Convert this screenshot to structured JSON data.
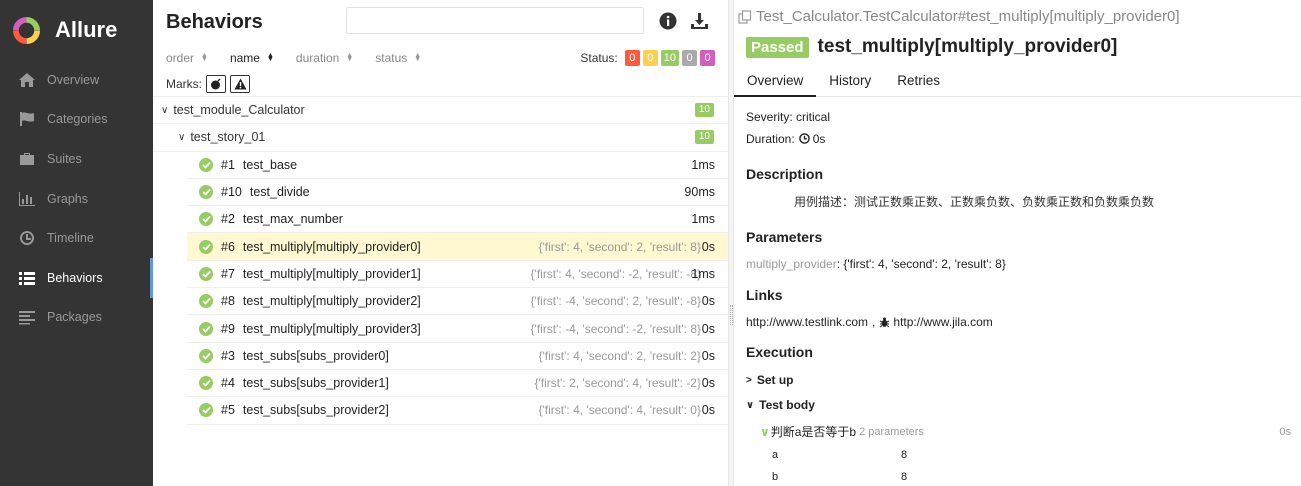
{
  "app": {
    "name": "Allure"
  },
  "sidebar": {
    "items": [
      {
        "label": "Overview",
        "icon": "home-icon",
        "active": false
      },
      {
        "label": "Categories",
        "icon": "flag-icon",
        "active": false
      },
      {
        "label": "Suites",
        "icon": "briefcase-icon",
        "active": false
      },
      {
        "label": "Graphs",
        "icon": "bar-chart-icon",
        "active": false
      },
      {
        "label": "Timeline",
        "icon": "clock-icon",
        "active": false
      },
      {
        "label": "Behaviors",
        "icon": "list-icon",
        "active": true
      },
      {
        "label": "Packages",
        "icon": "align-left-icon",
        "active": false
      }
    ]
  },
  "behaviors": {
    "title": "Behaviors",
    "search": {
      "value": "",
      "placeholder": ""
    },
    "sort": {
      "order": "order",
      "name": "name",
      "duration": "duration",
      "status": "status"
    },
    "status_filter": {
      "label": "Status:",
      "badges": [
        {
          "count": "0",
          "color": "#fd5a3e",
          "name": "failed"
        },
        {
          "count": "0",
          "color": "#ffd050",
          "name": "broken"
        },
        {
          "count": "10",
          "color": "#97cc64",
          "name": "passed"
        },
        {
          "count": "0",
          "color": "#aaaaaa",
          "name": "skipped"
        },
        {
          "count": "0",
          "color": "#d35ebe",
          "name": "unknown"
        }
      ]
    },
    "marks_label": "Marks:",
    "feature": {
      "name": "test_module_Calculator",
      "count": "10"
    },
    "story": {
      "name": "test_story_01",
      "count": "10"
    },
    "tests": [
      {
        "num": "#1",
        "name": "test_base",
        "params": "",
        "duration": "1ms"
      },
      {
        "num": "#10",
        "name": "test_divide",
        "params": "",
        "duration": "90ms"
      },
      {
        "num": "#2",
        "name": "test_max_number",
        "params": "",
        "duration": "1ms"
      },
      {
        "num": "#6",
        "name": "test_multiply[multiply_provider0]",
        "params": "{'first': 4, 'second': 2, 'result': 8}",
        "duration": "0s"
      },
      {
        "num": "#7",
        "name": "test_multiply[multiply_provider1]",
        "params": "{'first': 4, 'second': -2, 'result': -8}",
        "duration": "1ms"
      },
      {
        "num": "#8",
        "name": "test_multiply[multiply_provider2]",
        "params": "{'first': -4, 'second': 2, 'result': -8}",
        "duration": "0s"
      },
      {
        "num": "#9",
        "name": "test_multiply[multiply_provider3]",
        "params": "{'first': -4, 'second': -2, 'result': 8}",
        "duration": "0s"
      },
      {
        "num": "#3",
        "name": "test_subs[subs_provider0]",
        "params": "{'first': 4, 'second': 2, 'result': 2}",
        "duration": "0s"
      },
      {
        "num": "#4",
        "name": "test_subs[subs_provider1]",
        "params": "{'first': 2, 'second': 4, 'result': -2}",
        "duration": "0s"
      },
      {
        "num": "#5",
        "name": "test_subs[subs_provider2]",
        "params": "{'first': 4, 'second': 4, 'result': 0}",
        "duration": "0s"
      }
    ]
  },
  "detail": {
    "path": "Test_Calculator.TestCalculator#test_multiply[multiply_provider0]",
    "status": "Passed",
    "title": "test_multiply[multiply_provider0]",
    "tabs": {
      "overview": "Overview",
      "history": "History",
      "retries": "Retries"
    },
    "severity": "Severity: critical",
    "duration_label": "Duration:",
    "duration": "0s",
    "description_h": "Description",
    "description": "用例描述：测试正数乘正数、正数乘负数、负数乘正数和负数乘负数",
    "parameters_h": "Parameters",
    "param_name": "multiply_provider",
    "param_value": ": {'first': 4, 'second': 2, 'result': 8}",
    "links_h": "Links",
    "link1": "http://www.testlink.com",
    "link_sep": ",",
    "link2": "http://www.jila.com",
    "execution_h": "Execution",
    "setup": "Set up",
    "test_body": "Test body",
    "step_name": "判断a是否等于b",
    "step_params": "2 parameters",
    "step_duration": "0s",
    "step_table": [
      {
        "name": "a",
        "value": "8"
      },
      {
        "name": "b",
        "value": "8"
      }
    ]
  }
}
